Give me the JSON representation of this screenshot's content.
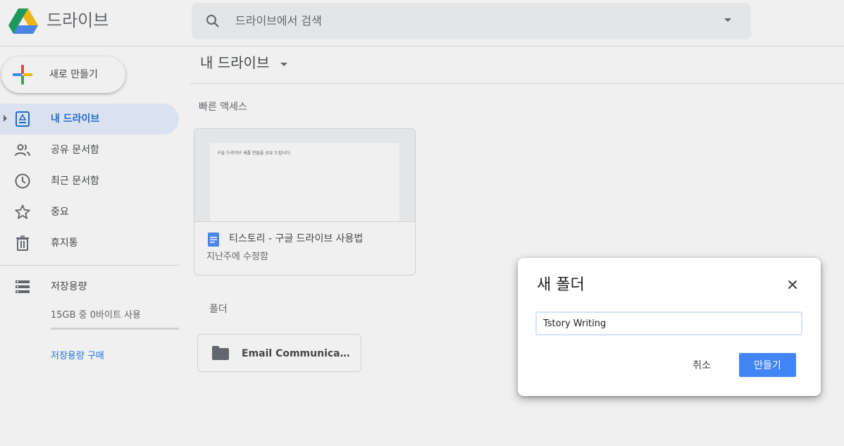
{
  "header": {
    "app_title": "드라이브",
    "search_placeholder": "드라이브에서 검색"
  },
  "sidebar": {
    "new_button": "새로 만들기",
    "items": [
      {
        "label": "내 드라이브",
        "icon": "my-drive-icon",
        "active": true
      },
      {
        "label": "공유 문서함",
        "icon": "people-icon"
      },
      {
        "label": "최근 문서함",
        "icon": "clock-icon"
      },
      {
        "label": "중요",
        "icon": "star-icon"
      },
      {
        "label": "휴지통",
        "icon": "trash-icon"
      },
      {
        "label": "저장용량",
        "icon": "storage-icon"
      }
    ],
    "storage_usage": "15GB 중 0바이트 사용",
    "storage_used_fraction": 0,
    "buy_storage": "저장용량 구매"
  },
  "main": {
    "title": "내 드라이브",
    "quick_access_label": "빠른 액세스",
    "quick_access": [
      {
        "name": "티스토리 - 구글 드라이브 사용법",
        "modified": "지난주에 수정함",
        "preview_text": "구글 드라이브 새폴 만들을 공유 드립니다."
      }
    ],
    "folders_label": "폴더",
    "folders": [
      {
        "name": "Email Communication ..."
      }
    ]
  },
  "dialog": {
    "title": "새 폴더",
    "input_value": "Tstory Writing",
    "cancel": "취소",
    "create": "만들기"
  },
  "colors": {
    "accent": "#1a73e8",
    "active_bg": "#e8f0fe",
    "create_button": "#4285f4",
    "doc_icon": "#4285f4"
  }
}
